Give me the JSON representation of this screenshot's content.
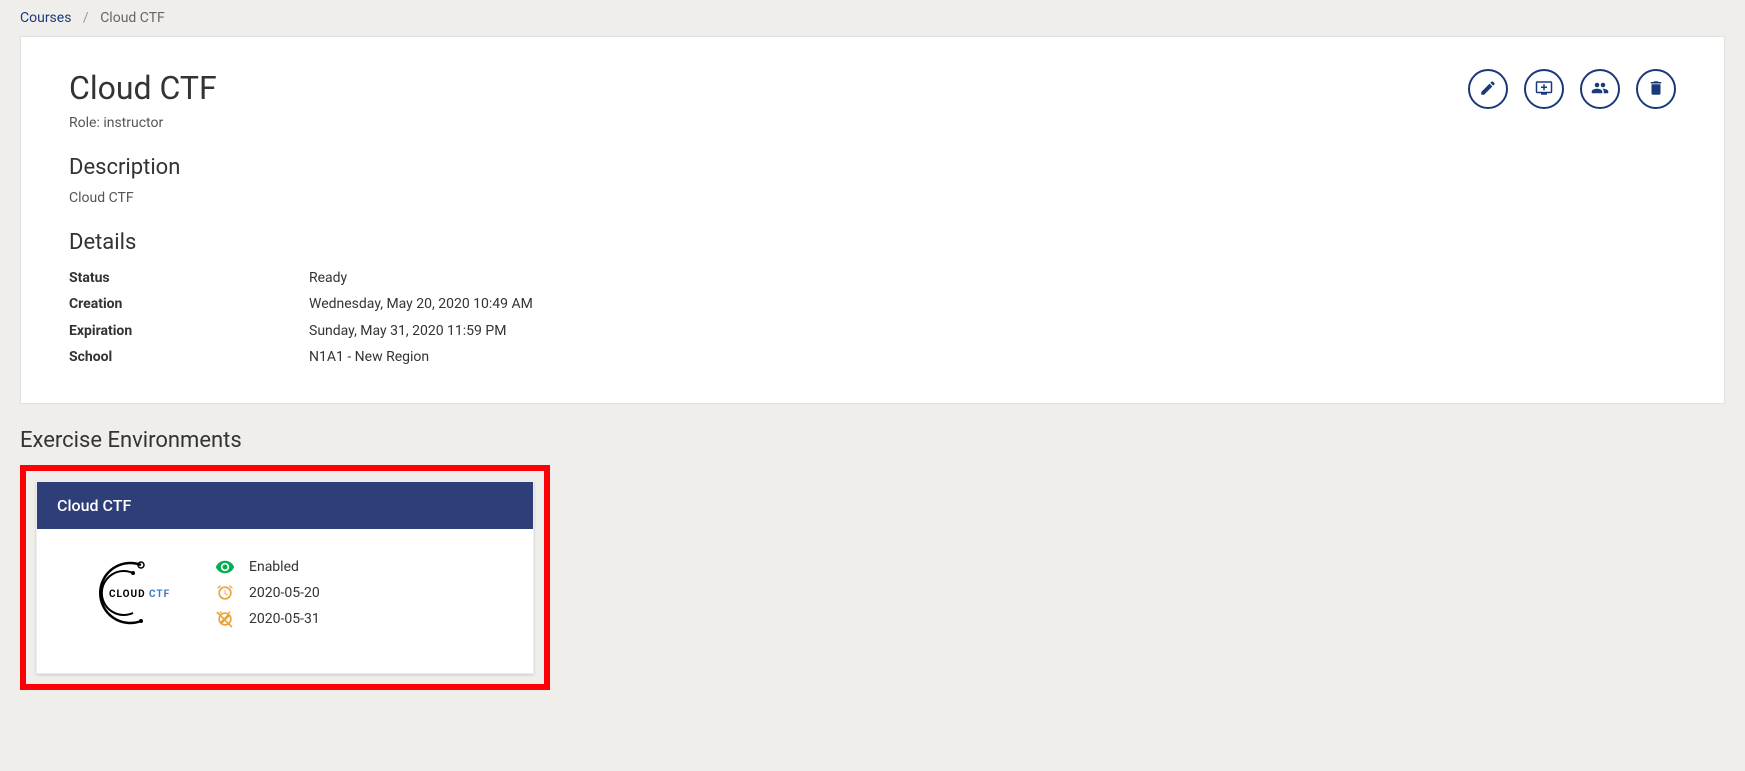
{
  "breadcrumb": {
    "root_label": "Courses",
    "current": "Cloud CTF"
  },
  "page": {
    "title": "Cloud CTF",
    "role_prefix": "Role: ",
    "role_value": "instructor",
    "description_heading": "Description",
    "description_text": "Cloud CTF",
    "details_heading": "Details",
    "details": {
      "status_label": "Status",
      "status_value": "Ready",
      "creation_label": "Creation",
      "creation_value": "Wednesday, May 20, 2020 10:49 AM",
      "expiration_label": "Expiration",
      "expiration_value": "Sunday, May 31, 2020 11:59 PM",
      "school_label": "School",
      "school_value": "N1A1 - New Region"
    }
  },
  "envs": {
    "section_title": "Exercise Environments",
    "card": {
      "title": "Cloud CTF",
      "logo_text_dark": "CLOUD",
      "logo_text_blue": "CTF",
      "status": "Enabled",
      "start": "2020-05-20",
      "end": "2020-05-31"
    }
  }
}
